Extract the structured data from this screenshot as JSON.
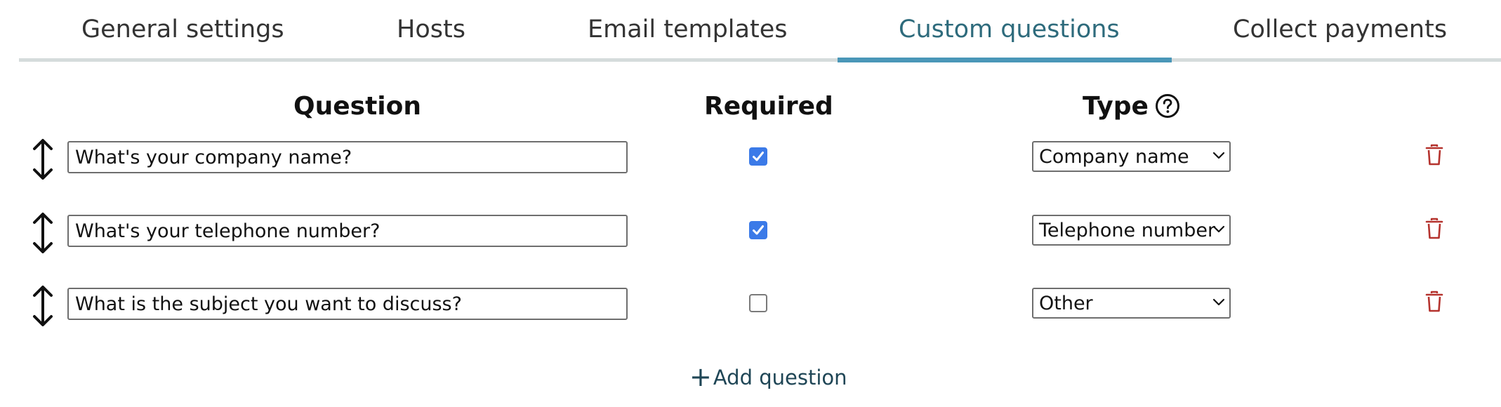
{
  "tabs": [
    {
      "label": "General settings",
      "active": false
    },
    {
      "label": "Hosts",
      "active": false
    },
    {
      "label": "Email templates",
      "active": false
    },
    {
      "label": "Custom questions",
      "active": true
    },
    {
      "label": "Collect payments",
      "active": false
    }
  ],
  "colors": {
    "active_tab_text": "#2e6b7c",
    "active_tab_bar": "#4a97b8",
    "checkbox_checked": "#3b7ae8",
    "delete_icon": "#b5332e",
    "add_link": "#1f4656"
  },
  "columns": {
    "question": "Question",
    "required": "Required",
    "type": "Type"
  },
  "icons": {
    "drag": "vertical-double-arrow",
    "help": "question-circle",
    "delete": "trash",
    "add": "plus"
  },
  "questions": [
    {
      "text": "What's your company name?",
      "required": true,
      "type": "Company name"
    },
    {
      "text": "What's your telephone number?",
      "required": true,
      "type": "Telephone number"
    },
    {
      "text": "What is the subject you want to discuss?",
      "required": false,
      "type": "Other"
    }
  ],
  "add_question": {
    "icon_glyph": "+",
    "label": "Add question"
  }
}
